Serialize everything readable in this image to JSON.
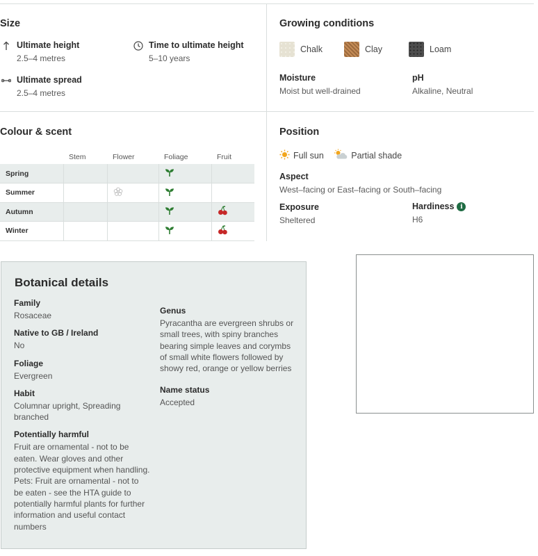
{
  "size": {
    "title": "Size",
    "ultimate_height": {
      "label": "Ultimate height",
      "value": "2.5–4 metres"
    },
    "time_to_height": {
      "label": "Time to ultimate height",
      "value": "5–10 years"
    },
    "ultimate_spread": {
      "label": "Ultimate spread",
      "value": "2.5–4 metres"
    }
  },
  "growing": {
    "title": "Growing conditions",
    "soils": [
      {
        "name": "Chalk",
        "color": "#e6e2d3"
      },
      {
        "name": "Clay",
        "color": "#b07a48"
      },
      {
        "name": "Loam",
        "color": "#4d4d4d"
      }
    ],
    "moisture": {
      "label": "Moisture",
      "value": "Moist but well-drained"
    },
    "ph": {
      "label": "pH",
      "value": "Alkaline, Neutral"
    }
  },
  "colour": {
    "title": "Colour & scent",
    "columns": [
      "Stem",
      "Flower",
      "Foliage",
      "Fruit"
    ],
    "seasons": [
      "Spring",
      "Summer",
      "Autumn",
      "Winter"
    ]
  },
  "position": {
    "title": "Position",
    "sun": [
      "Full sun",
      "Partial shade"
    ],
    "aspect": {
      "label": "Aspect",
      "value": "West–facing or East–facing or South–facing"
    },
    "exposure": {
      "label": "Exposure",
      "value": "Sheltered"
    },
    "hardiness": {
      "label": "Hardiness",
      "value": "H6"
    }
  },
  "botanical": {
    "title": "Botanical details",
    "family": {
      "label": "Family",
      "value": "Rosaceae"
    },
    "native": {
      "label": "Native to GB / Ireland",
      "value": "No"
    },
    "foliage": {
      "label": "Foliage",
      "value": "Evergreen"
    },
    "habit": {
      "label": "Habit",
      "value": "Columnar upright, Spreading branched"
    },
    "harmful": {
      "label": "Potentially harmful",
      "value": "Fruit are ornamental - not to be eaten. Wear gloves and other protective equipment when handling. Pets: Fruit are ornamental - not to be eaten - see the HTA guide to potentially harmful plants for further information and useful contact numbers"
    },
    "genus": {
      "label": "Genus",
      "value": "Pyracantha are evergreen shrubs or small trees, with spiny branches bearing simple leaves and corymbs of small white flowers followed by showy red, orange or yellow berries"
    },
    "name_status": {
      "label": "Name status",
      "value": "Accepted"
    }
  },
  "colors": {
    "leaf": "#2e7d32",
    "berry": "#c62828",
    "accent": "#1f6b43",
    "panel": "#e8edec"
  },
  "icons": [
    "height-arrow-icon",
    "clock-icon",
    "spread-arrow-icon",
    "sun-icon",
    "partial-shade-icon",
    "leaf-icon",
    "flower-icon",
    "berries-icon",
    "info-icon"
  ]
}
